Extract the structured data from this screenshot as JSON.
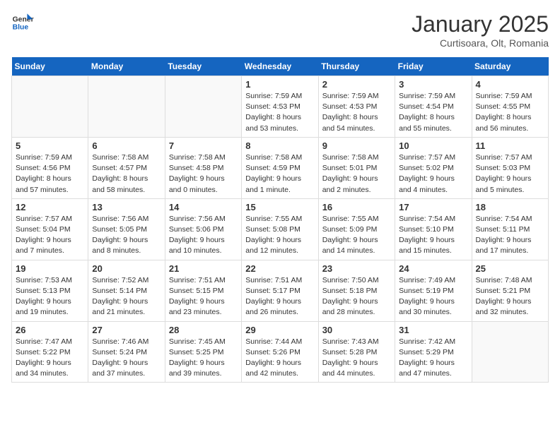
{
  "logo": {
    "line1": "General",
    "line2": "Blue"
  },
  "title": "January 2025",
  "subtitle": "Curtisoara, Olt, Romania",
  "weekdays": [
    "Sunday",
    "Monday",
    "Tuesday",
    "Wednesday",
    "Thursday",
    "Friday",
    "Saturday"
  ],
  "weeks": [
    [
      {
        "day": "",
        "info": ""
      },
      {
        "day": "",
        "info": ""
      },
      {
        "day": "",
        "info": ""
      },
      {
        "day": "1",
        "info": "Sunrise: 7:59 AM\nSunset: 4:53 PM\nDaylight: 8 hours\nand 53 minutes."
      },
      {
        "day": "2",
        "info": "Sunrise: 7:59 AM\nSunset: 4:53 PM\nDaylight: 8 hours\nand 54 minutes."
      },
      {
        "day": "3",
        "info": "Sunrise: 7:59 AM\nSunset: 4:54 PM\nDaylight: 8 hours\nand 55 minutes."
      },
      {
        "day": "4",
        "info": "Sunrise: 7:59 AM\nSunset: 4:55 PM\nDaylight: 8 hours\nand 56 minutes."
      }
    ],
    [
      {
        "day": "5",
        "info": "Sunrise: 7:59 AM\nSunset: 4:56 PM\nDaylight: 8 hours\nand 57 minutes."
      },
      {
        "day": "6",
        "info": "Sunrise: 7:58 AM\nSunset: 4:57 PM\nDaylight: 8 hours\nand 58 minutes."
      },
      {
        "day": "7",
        "info": "Sunrise: 7:58 AM\nSunset: 4:58 PM\nDaylight: 9 hours\nand 0 minutes."
      },
      {
        "day": "8",
        "info": "Sunrise: 7:58 AM\nSunset: 4:59 PM\nDaylight: 9 hours\nand 1 minute."
      },
      {
        "day": "9",
        "info": "Sunrise: 7:58 AM\nSunset: 5:01 PM\nDaylight: 9 hours\nand 2 minutes."
      },
      {
        "day": "10",
        "info": "Sunrise: 7:57 AM\nSunset: 5:02 PM\nDaylight: 9 hours\nand 4 minutes."
      },
      {
        "day": "11",
        "info": "Sunrise: 7:57 AM\nSunset: 5:03 PM\nDaylight: 9 hours\nand 5 minutes."
      }
    ],
    [
      {
        "day": "12",
        "info": "Sunrise: 7:57 AM\nSunset: 5:04 PM\nDaylight: 9 hours\nand 7 minutes."
      },
      {
        "day": "13",
        "info": "Sunrise: 7:56 AM\nSunset: 5:05 PM\nDaylight: 9 hours\nand 8 minutes."
      },
      {
        "day": "14",
        "info": "Sunrise: 7:56 AM\nSunset: 5:06 PM\nDaylight: 9 hours\nand 10 minutes."
      },
      {
        "day": "15",
        "info": "Sunrise: 7:55 AM\nSunset: 5:08 PM\nDaylight: 9 hours\nand 12 minutes."
      },
      {
        "day": "16",
        "info": "Sunrise: 7:55 AM\nSunset: 5:09 PM\nDaylight: 9 hours\nand 14 minutes."
      },
      {
        "day": "17",
        "info": "Sunrise: 7:54 AM\nSunset: 5:10 PM\nDaylight: 9 hours\nand 15 minutes."
      },
      {
        "day": "18",
        "info": "Sunrise: 7:54 AM\nSunset: 5:11 PM\nDaylight: 9 hours\nand 17 minutes."
      }
    ],
    [
      {
        "day": "19",
        "info": "Sunrise: 7:53 AM\nSunset: 5:13 PM\nDaylight: 9 hours\nand 19 minutes."
      },
      {
        "day": "20",
        "info": "Sunrise: 7:52 AM\nSunset: 5:14 PM\nDaylight: 9 hours\nand 21 minutes."
      },
      {
        "day": "21",
        "info": "Sunrise: 7:51 AM\nSunset: 5:15 PM\nDaylight: 9 hours\nand 23 minutes."
      },
      {
        "day": "22",
        "info": "Sunrise: 7:51 AM\nSunset: 5:17 PM\nDaylight: 9 hours\nand 26 minutes."
      },
      {
        "day": "23",
        "info": "Sunrise: 7:50 AM\nSunset: 5:18 PM\nDaylight: 9 hours\nand 28 minutes."
      },
      {
        "day": "24",
        "info": "Sunrise: 7:49 AM\nSunset: 5:19 PM\nDaylight: 9 hours\nand 30 minutes."
      },
      {
        "day": "25",
        "info": "Sunrise: 7:48 AM\nSunset: 5:21 PM\nDaylight: 9 hours\nand 32 minutes."
      }
    ],
    [
      {
        "day": "26",
        "info": "Sunrise: 7:47 AM\nSunset: 5:22 PM\nDaylight: 9 hours\nand 34 minutes."
      },
      {
        "day": "27",
        "info": "Sunrise: 7:46 AM\nSunset: 5:24 PM\nDaylight: 9 hours\nand 37 minutes."
      },
      {
        "day": "28",
        "info": "Sunrise: 7:45 AM\nSunset: 5:25 PM\nDaylight: 9 hours\nand 39 minutes."
      },
      {
        "day": "29",
        "info": "Sunrise: 7:44 AM\nSunset: 5:26 PM\nDaylight: 9 hours\nand 42 minutes."
      },
      {
        "day": "30",
        "info": "Sunrise: 7:43 AM\nSunset: 5:28 PM\nDaylight: 9 hours\nand 44 minutes."
      },
      {
        "day": "31",
        "info": "Sunrise: 7:42 AM\nSunset: 5:29 PM\nDaylight: 9 hours\nand 47 minutes."
      },
      {
        "day": "",
        "info": ""
      }
    ]
  ]
}
